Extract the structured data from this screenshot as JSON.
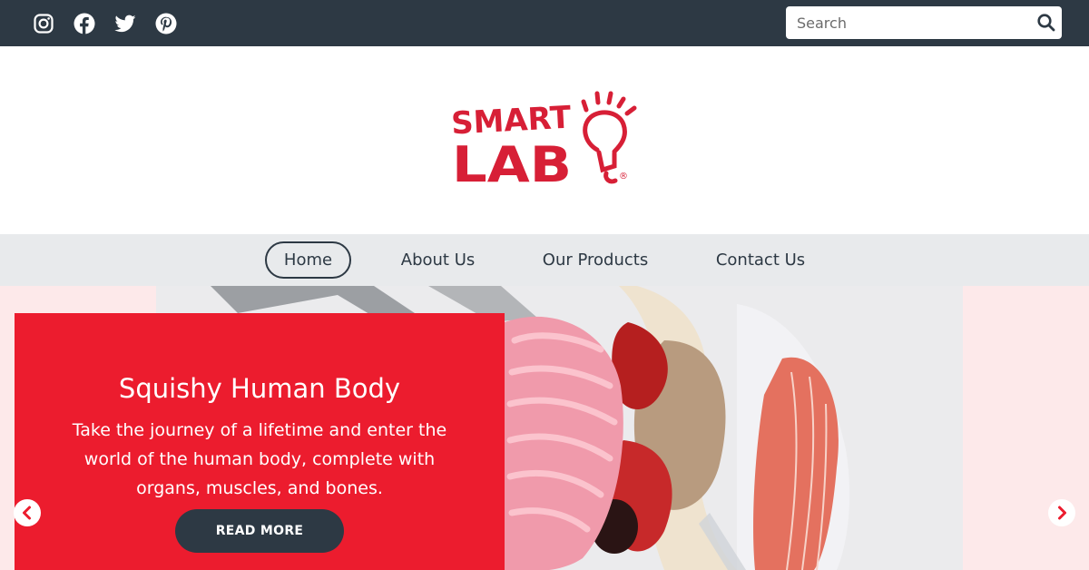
{
  "social": {
    "items": [
      {
        "icon": "instagram-icon"
      },
      {
        "icon": "facebook-icon"
      },
      {
        "icon": "twitter-icon"
      },
      {
        "icon": "pinterest-icon"
      }
    ]
  },
  "search": {
    "placeholder": "Search",
    "value": "",
    "icon": "search-icon"
  },
  "logo": {
    "line1": "SMART",
    "line2": "LAB",
    "mark": "®",
    "color": "#d71f36"
  },
  "nav": {
    "items": [
      {
        "label": "Home",
        "active": true
      },
      {
        "label": "About Us",
        "active": false
      },
      {
        "label": "Our Products",
        "active": false
      },
      {
        "label": "Contact Us",
        "active": false
      }
    ]
  },
  "hero": {
    "title": "Squishy Human Body",
    "text": "Take the journey of a lifetime and enter the world of the human body, complete with organs, muscles, and bones.",
    "button_label": "READ MORE",
    "prev_icon": "chevron-left-icon",
    "next_icon": "chevron-right-icon"
  },
  "colors": {
    "topbar": "#2d3944",
    "accent_red": "#ec1c2e",
    "nav_bg": "#e8eaec",
    "hero_bg": "#fde9ea"
  }
}
